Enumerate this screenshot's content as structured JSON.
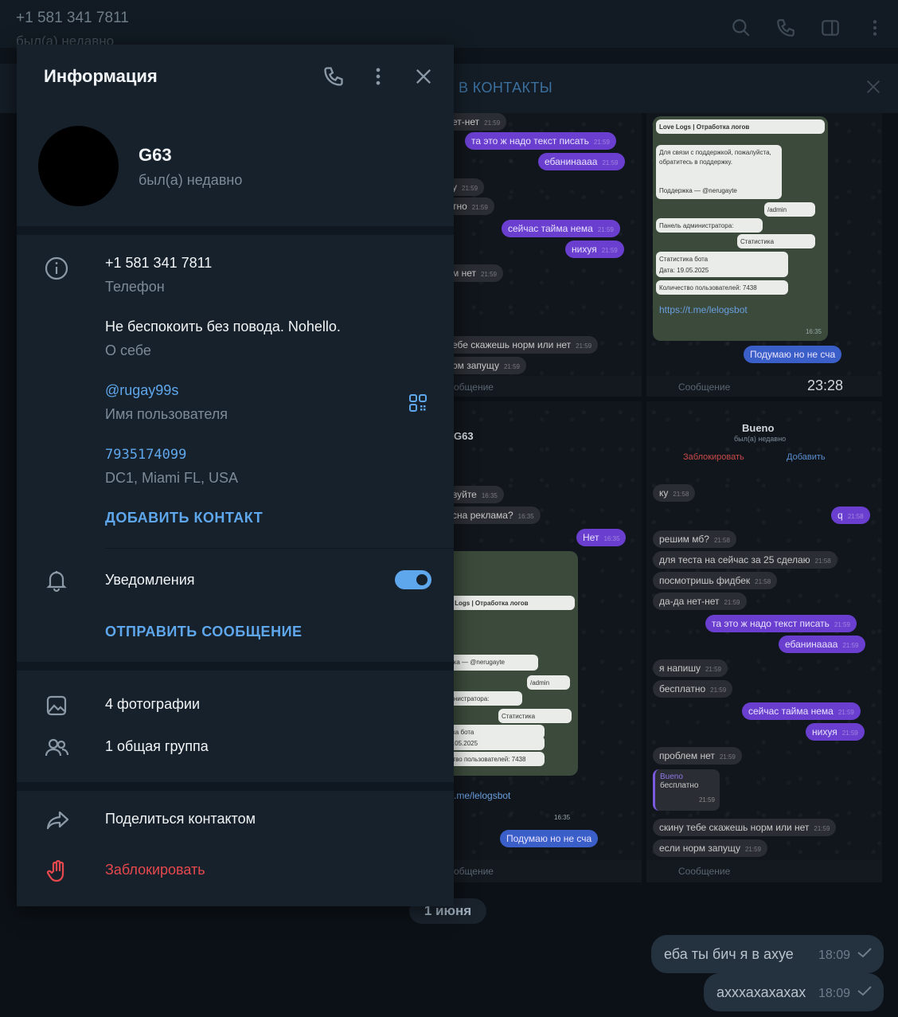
{
  "topbar": {
    "phone": "+1 581 341 7811",
    "status": "был(а) недавно",
    "icons": [
      "search-icon",
      "phone-icon",
      "sidebar-toggle-icon",
      "more-vertical-icon"
    ]
  },
  "addbar": {
    "add_to_contacts": "В КОНТАКТЫ"
  },
  "background_chat": {
    "screenshot_1": {
      "messages": [
        {
          "dir": "in",
          "text": "ет-нет",
          "time": "21:59"
        },
        {
          "dir": "out",
          "text": "та это ж надо текст писать",
          "time": "21:59"
        },
        {
          "dir": "out",
          "text": "ебанинаааа",
          "time": "21:59"
        },
        {
          "dir": "in",
          "text": "у",
          "time": "21:59"
        },
        {
          "dir": "in",
          "text": "тно",
          "time": "21:59"
        },
        {
          "dir": "out",
          "text": "сейчас тайма нема",
          "time": "21:59"
        },
        {
          "dir": "out",
          "text": "нихуя",
          "time": "21:59"
        },
        {
          "dir": "in",
          "text": "м нет",
          "time": "21:59"
        },
        {
          "dir": "in",
          "text": "ебе скажешь норм или нет",
          "time": "21:59"
        },
        {
          "dir": "in",
          "text": "рм запущу",
          "time": "21:59"
        }
      ],
      "input_placeholder": "общение"
    },
    "screenshot_2": {
      "card_title": "Love Logs | Отработка логов",
      "card_text": "Для связи с поддержкой, пожалуйста, обратитесь в поддержку.",
      "support": "Поддержка — @nerugayte",
      "admin": "/admin",
      "panel": "Панель администратора:",
      "stats": "Статистика",
      "stats_bot": "Статистика бота",
      "date": "Дата: 19.05.2025",
      "users": "Количество пользователей: 7438",
      "link": "https://t.me/lelogsbot",
      "link_time": "16:35",
      "reply": "Подумаю но не сча",
      "input_placeholder": "Сообщение",
      "record_time": "23:28"
    },
    "screenshot_3": {
      "title": "G63",
      "messages": [
        {
          "dir": "in",
          "text": "вуйте",
          "time": "16:35"
        },
        {
          "dir": "in",
          "text": "сна реклама?",
          "time": "16:35"
        },
        {
          "dir": "out",
          "text": "Нет",
          "time": "16:35"
        }
      ],
      "card_title": "ve Logs | Отработка логов",
      "support": "ожка — @nerugayte",
      "admin": "/admin",
      "panel": "министратора:",
      "stats": "Статистика",
      "stats_bot": "тика бота",
      "date": "19.05.2025",
      "users": "ество пользователей: 7438",
      "link": ".me/lelogsbot",
      "link_time": "16:35",
      "reply": "Подумаю но не сча",
      "input_placeholder": "общение"
    },
    "screenshot_4": {
      "name": "Bueno",
      "status": "был(а) недавно",
      "block": "Заблокировать",
      "add": "Добавить",
      "messages": [
        {
          "dir": "in",
          "text": "ку",
          "time": "21:58"
        },
        {
          "dir": "out",
          "text": "q",
          "time": "21:58"
        },
        {
          "dir": "in",
          "text": "решим мб?",
          "time": "21:58"
        },
        {
          "dir": "in",
          "text": "для теста на сейчас за 25 сделаю",
          "time": "21:58"
        },
        {
          "dir": "in",
          "text": "посмотришь фидбек",
          "time": "21:58"
        },
        {
          "dir": "in",
          "text": "да-да нет-нет",
          "time": "21:59"
        },
        {
          "dir": "out",
          "text": "та это ж надо текст писать",
          "time": "21:59"
        },
        {
          "dir": "out",
          "text": "ебанинаааа",
          "time": "21:59"
        },
        {
          "dir": "in",
          "text": "я напишу",
          "time": "21:59"
        },
        {
          "dir": "in",
          "text": "бесплатно",
          "time": "21:59"
        },
        {
          "dir": "out",
          "text": "сейчас тайма нема",
          "time": "21:59"
        },
        {
          "dir": "out",
          "text": "нихуя",
          "time": "21:59"
        },
        {
          "dir": "in",
          "text": "проблем нет",
          "time": "21:59"
        },
        {
          "dir": "in",
          "text": "скину тебе скажешь норм или нет",
          "time": "21:59"
        },
        {
          "dir": "in",
          "text": "если норм запущу",
          "time": "21:59"
        }
      ],
      "quote_name": "Bueno",
      "quote_text": "бесплатно",
      "quote_time": "21:59",
      "input_placeholder": "Сообщение"
    },
    "date_chip": "1 июня",
    "own_messages": [
      {
        "text": "еба ты бич я в ахуе",
        "time": "18:09"
      },
      {
        "text": "ахххахахахах",
        "time": "18:09"
      }
    ]
  },
  "panel": {
    "title": "Информация",
    "header_icons": [
      "phone-icon",
      "more-vertical-icon",
      "close-icon"
    ],
    "name": "G63",
    "status": "был(а) недавно",
    "phone": "+1 581 341 7811",
    "phone_label": "Телефон",
    "bio": "Не беспокоить без повода. Nohello.",
    "bio_label": "О себе",
    "username": "@rugay99s",
    "username_label": "Имя пользователя",
    "user_id": "7935174099",
    "dc": "DC1, Miami FL, USA",
    "add_contact": "ДОБАВИТЬ КОНТАКТ",
    "notifications": "Уведомления",
    "notifications_on": true,
    "send_message": "ОТПРАВИТЬ СООБЩЕНИЕ",
    "photos": "4 фотографии",
    "groups": "1 общая группа",
    "share": "Поделиться контактом",
    "block": "Заблокировать",
    "accent": "#5fa7ec",
    "danger": "#e5484d"
  }
}
